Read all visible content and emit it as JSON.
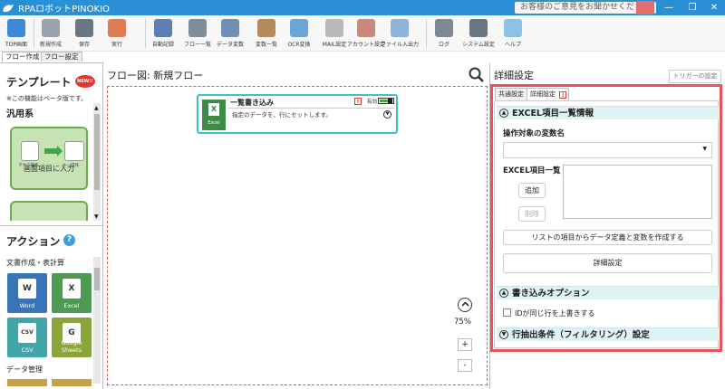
{
  "app": {
    "title": "RPAロボットPINOKIO",
    "feedback": "お客様のご意見をお聞かせください"
  },
  "window": {
    "minimize": "—",
    "restore": "❐",
    "close": "✕"
  },
  "toolbar": [
    {
      "label": "TOP画面",
      "icon": "home-icon",
      "color": "#3f8ad8"
    },
    {
      "label": "新規作成",
      "icon": "new-file-icon",
      "color": "#9aa3ad"
    },
    {
      "label": "保存",
      "icon": "save-icon",
      "color": "#6a7884"
    },
    {
      "label": "実行",
      "icon": "run-icon",
      "color": "#e07d55"
    },
    {
      "label": "自動記録",
      "icon": "record-icon",
      "color": "#5f7fb2"
    },
    {
      "label": "フロー一覧",
      "icon": "list-icon",
      "color": "#7f8c99"
    },
    {
      "label": "データ変数",
      "icon": "database-icon",
      "color": "#6f8fb5"
    },
    {
      "label": "変数一覧",
      "icon": "box-icon",
      "color": "#b38a5a"
    },
    {
      "label": "OCR変換",
      "icon": "ocr-icon",
      "color": "#6aa5d8"
    },
    {
      "label": "MAIL設定",
      "icon": "mail-icon",
      "color": "#b9b9b9"
    },
    {
      "label": "アカウント設定",
      "icon": "account-icon",
      "color": "#c98a7d"
    },
    {
      "label": "ファイル入出力",
      "icon": "file-io-icon",
      "color": "#8fb3d8"
    },
    {
      "label": "ログ",
      "icon": "log-icon",
      "color": "#7d8a96"
    },
    {
      "label": "システム設定",
      "icon": "gear-icon",
      "color": "#6b7580"
    },
    {
      "label": "ヘルプ",
      "icon": "help-icon",
      "color": "#8fc3e6"
    }
  ],
  "tabs": [
    "フロー作成",
    "フロー設定"
  ],
  "left": {
    "template_title": "テンプレート",
    "new_badge": "NEW!!",
    "beta_note": "※この機能はベータ版です。",
    "category": "汎用系",
    "template_card_label": "画面項目に入力",
    "template_card_sub1": "マウス操作",
    "template_card_sub2": "キー操作",
    "action_title": "アクション",
    "action_help": "?",
    "action_category": "文書作成・表計算",
    "actions": [
      {
        "label": "Word",
        "letter": "W",
        "color": "#3a74b8"
      },
      {
        "label": "Excel",
        "letter": "X",
        "color": "#4e9a53"
      },
      {
        "label": "CSV",
        "letter": "CSV",
        "color": "#42a6a8"
      },
      {
        "label": "Google Sheets",
        "letter": "G",
        "color": "#8aa63a"
      }
    ],
    "data_category": "データ管理"
  },
  "center": {
    "flow_title": "フロー図:  新規フロー",
    "node": {
      "title": "一覧書き込み",
      "badge": "Excel",
      "description": "指定のデータを、行にセットします。",
      "enabled": "有効",
      "warning": "!"
    },
    "zoom": "75%",
    "zoom_in": "+",
    "zoom_out": "-"
  },
  "right": {
    "title": "詳細設定",
    "trigger_button": "トリガーの設定",
    "tab_common": "共通設定",
    "tab_detail": "詳細設定",
    "tab_warning": "!",
    "section1": "EXCEL項目一覧情報",
    "target_var_label": "操作対象の変数名",
    "excel_list_label": "EXCEL項目一覧",
    "add_button": "追加",
    "delete_button": "削除",
    "create_button": "リストの項目からデータ定義と変数を作成する",
    "detail_button": "詳細設定",
    "section2": "書き込みオプション",
    "overwrite_label": "IDが同じ行を上書きする",
    "section3": "行抽出条件（フィルタリング）設定"
  }
}
